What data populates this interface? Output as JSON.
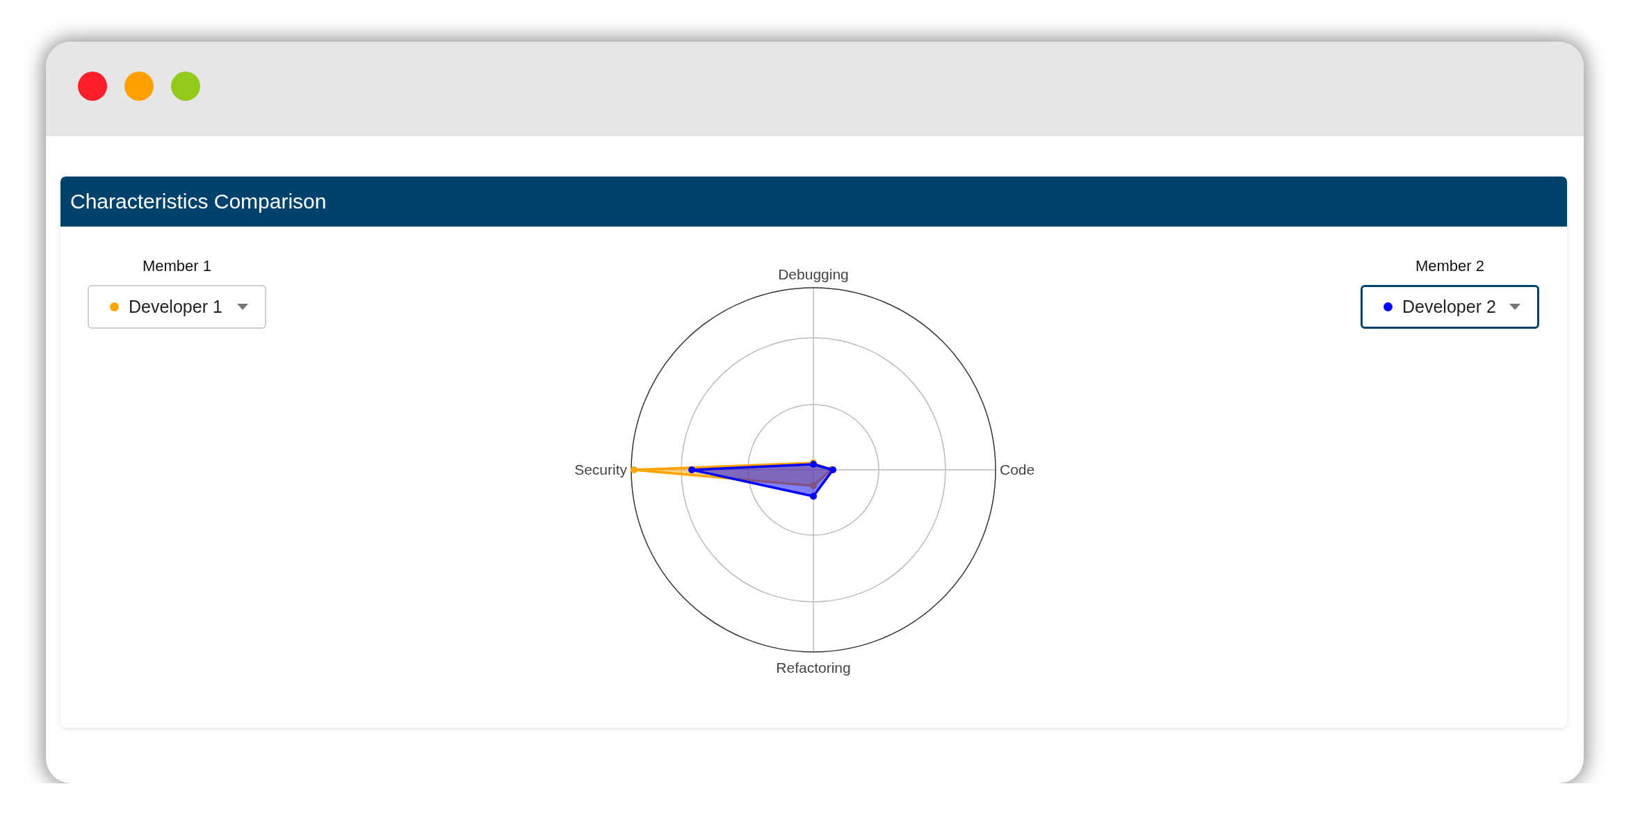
{
  "window": {
    "controls": [
      {
        "color": "#ff1f2a"
      },
      {
        "color": "#ffa000"
      },
      {
        "color": "#93c91b"
      }
    ]
  },
  "panel": {
    "title": "Characteristics Comparison",
    "members": [
      {
        "label": "Member 1",
        "value": "Developer 1",
        "color": "#ffa500",
        "focused": false
      },
      {
        "label": "Member 2",
        "value": "Developer 2",
        "color": "#0000ff",
        "focused": true
      }
    ],
    "radar": {
      "axes": [
        "Debugging",
        "Code",
        "Refactoring",
        "Security"
      ]
    }
  }
}
